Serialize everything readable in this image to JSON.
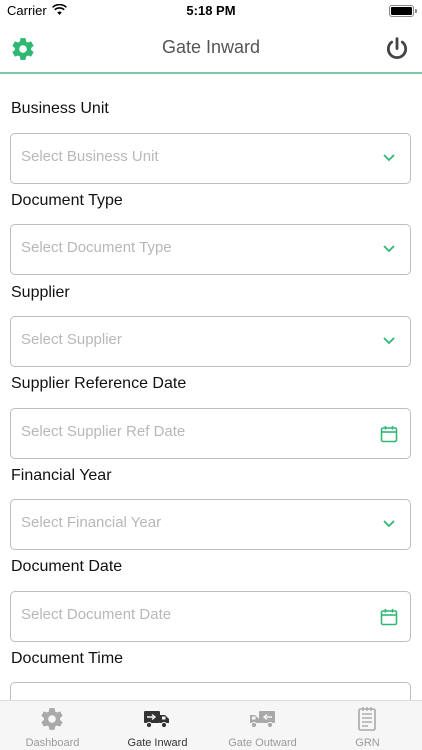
{
  "status_bar": {
    "carrier": "Carrier",
    "time": "5:18 PM"
  },
  "header": {
    "title": "Gate Inward",
    "left_icon": "gear-icon",
    "right_icon": "power-icon",
    "accent_color": "#2eb873"
  },
  "form": {
    "fields": [
      {
        "label": "Business Unit",
        "placeholder": "Select Business Unit",
        "icon": "chevron-down-icon"
      },
      {
        "label": "Document Type",
        "placeholder": "Select Document Type",
        "icon": "chevron-down-icon"
      },
      {
        "label": "Supplier",
        "placeholder": "Select Supplier",
        "icon": "chevron-down-icon"
      },
      {
        "label": "Supplier Reference Date",
        "placeholder": "Select Supplier Ref Date",
        "icon": "calendar-icon"
      },
      {
        "label": "Financial Year",
        "placeholder": "Select Financial Year",
        "icon": "chevron-down-icon"
      },
      {
        "label": "Document Date",
        "placeholder": "Select Document Date",
        "icon": "calendar-icon"
      },
      {
        "label": "Document Time",
        "placeholder": "",
        "icon": ""
      }
    ]
  },
  "tab_bar": {
    "tabs": [
      {
        "label": "Dashboard",
        "icon": "gear-icon"
      },
      {
        "label": "Gate Inward",
        "icon": "truck-icon",
        "active": true
      },
      {
        "label": "Gate Outward",
        "icon": "truck-icon"
      },
      {
        "label": "GRN",
        "icon": "document-icon"
      }
    ]
  }
}
